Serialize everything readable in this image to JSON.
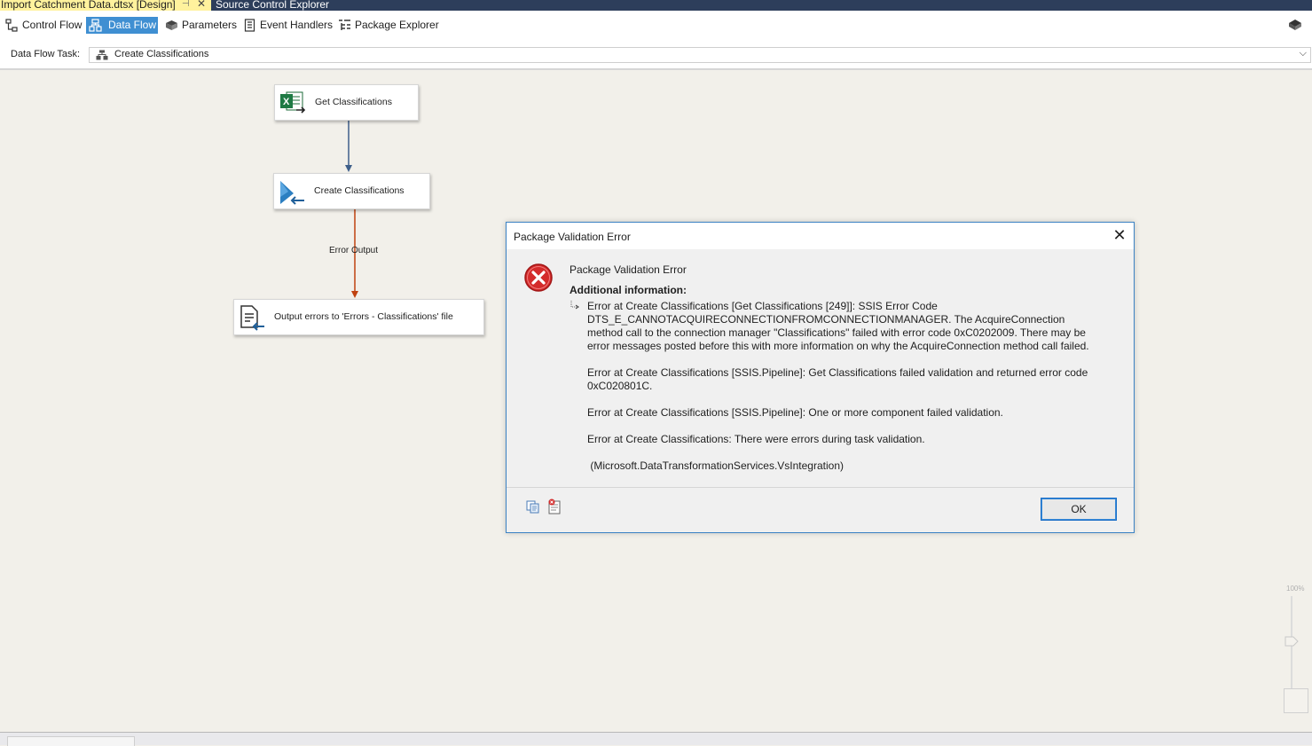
{
  "document_tabs": [
    {
      "label": "Import Catchment Data.dtsx [Design]",
      "active": true
    },
    {
      "label": "Source Control Explorer",
      "active": false
    }
  ],
  "designer_tabs": [
    {
      "label": "Control Flow",
      "icon": "control-flow-icon"
    },
    {
      "label": "Data Flow",
      "icon": "data-flow-icon",
      "selected": true
    },
    {
      "label": "Parameters",
      "icon": "parameters-icon"
    },
    {
      "label": "Event Handlers",
      "icon": "event-handlers-icon"
    },
    {
      "label": "Package Explorer",
      "icon": "package-explorer-icon"
    }
  ],
  "task_bar": {
    "label": "Data Flow Task:",
    "selected_task": "Create Classifications"
  },
  "components": [
    {
      "label": "Get Classifications",
      "icon": "excel-source-icon"
    },
    {
      "label": "Create Classifications",
      "icon": "oledb-destination-icon"
    },
    {
      "label": "Output errors to 'Errors - Classifications' file",
      "icon": "flat-file-destination-icon"
    }
  ],
  "paths": [
    {
      "label": "",
      "color": "#3f5f8a"
    },
    {
      "label": "Error Output",
      "color": "#c0420f"
    }
  ],
  "dialog": {
    "title": "Package Validation Error",
    "heading": "Package Validation Error",
    "additional_info_label": "Additional information:",
    "messages": [
      "Error at Create Classifications [Get Classifications [249]]: SSIS Error Code DTS_E_CANNOTACQUIRECONNECTIONFROMCONNECTIONMANAGER.  The AcquireConnection method call to the connection manager \"Classifications\" failed with error code 0xC0202009.  There may be error messages posted before this with more information on why the AcquireConnection method call failed.",
      "Error at Create Classifications [SSIS.Pipeline]: Get Classifications failed validation and returned error code 0xC020801C.",
      "Error at Create Classifications [SSIS.Pipeline]: One or more component failed validation.",
      "Error at Create Classifications: There were errors during task validation.",
      " (Microsoft.DataTransformationServices.VsIntegration)"
    ],
    "ok_label": "OK"
  },
  "zoom": {
    "label": "100%"
  }
}
